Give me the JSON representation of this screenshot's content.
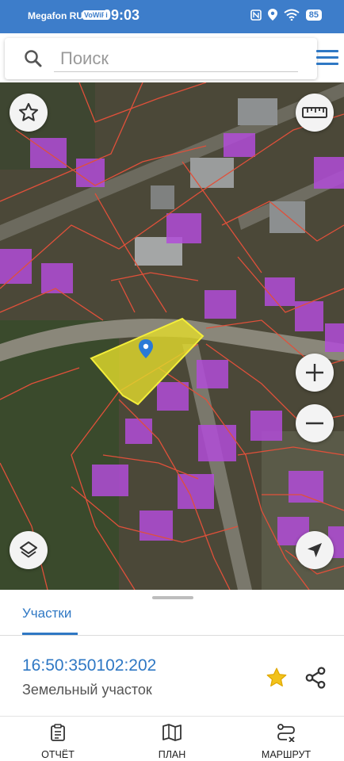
{
  "status_bar": {
    "carrier": "Megafon RUS",
    "volte": "VoWiFi",
    "time": "09:03",
    "battery": "85"
  },
  "search": {
    "placeholder": "Поиск"
  },
  "colors": {
    "accent": "#2f78c4",
    "status_bar": "#3d7dca",
    "parcel_selected": "#e4dc2c",
    "building": "#b24cd8",
    "parcel_border": "#e0503a",
    "favorite_star": "#f2c21b"
  },
  "map_controls": [
    "star-icon",
    "ruler-icon",
    "zoom-in-icon",
    "zoom-out-icon",
    "layers-icon",
    "navigation-arrow-icon"
  ],
  "sheet": {
    "tab": "Участки",
    "parcel": {
      "cadastral_number": "16:50:350102:202",
      "type": "Земельный участок"
    }
  },
  "bottom_nav": [
    {
      "label": "ОТЧЁТ",
      "icon": "report-icon"
    },
    {
      "label": "ПЛАН",
      "icon": "plan-map-icon"
    },
    {
      "label": "МАРШРУТ",
      "icon": "route-icon"
    }
  ]
}
